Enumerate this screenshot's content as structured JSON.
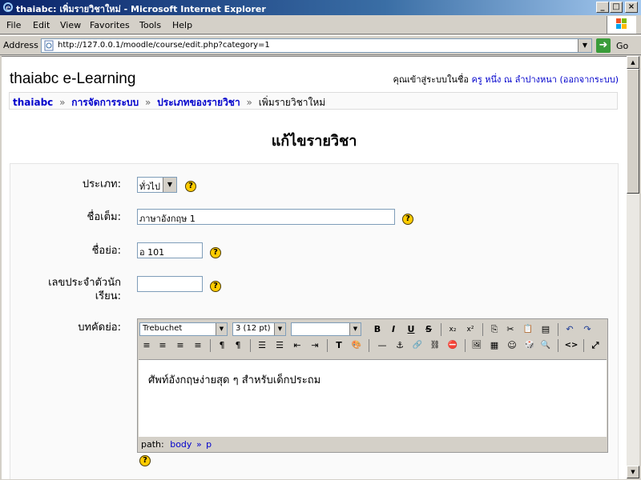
{
  "window": {
    "title": "thaiabc: เพิ่มรายวิชาใหม่ - Microsoft Internet Explorer",
    "buttons": {
      "minimize": "_",
      "maximize": "□",
      "close": "×"
    }
  },
  "menu": [
    "File",
    "Edit",
    "View",
    "Favorites",
    "Tools",
    "Help"
  ],
  "address": {
    "label": "Address",
    "url": "http://127.0.0.1/moodle/course/edit.php?category=1",
    "go_label": "Go"
  },
  "page": {
    "site_name": "thaiabc e-Learning",
    "login": {
      "prefix": "คุณเข้าสู่ระบบในชื่อ",
      "user": "ครู หนึ่ง ณ ลำปางหนา",
      "logout_open": "(",
      "logout": "ออกจากระบบ",
      "logout_close": ")"
    },
    "breadcrumb": {
      "items": [
        "thaiabc",
        "การจัดการระบบ",
        "ประเภทของรายวิชา"
      ],
      "current": "เพิ่มรายวิชาใหม่",
      "separator": "»"
    },
    "heading": "แก้ไขรายวิชา",
    "form": {
      "category": {
        "label": "ประเภท:",
        "value": "ทั่วไป"
      },
      "fullname": {
        "label": "ชื่อเต็ม:",
        "value": "ภาษาอังกฤษ 1"
      },
      "shortname": {
        "label": "ชื่อย่อ:",
        "value": "อ 101"
      },
      "idnumber": {
        "label1": "เลขประจำตัวนัก",
        "label2": "เรียน:",
        "value": ""
      },
      "summary": {
        "label": "บทคัดย่อ:"
      }
    },
    "editor": {
      "font": "Trebuchet",
      "size": "3 (12 pt)",
      "style": "",
      "content": "ศัพท์อังกฤษง่ายสุด ๆ สำหรับเด็กประถม",
      "path_label": "path:",
      "path_items": [
        "body",
        "p"
      ],
      "path_sep": "»",
      "buttons_row1": [
        "B",
        "I",
        "U",
        "S",
        "x₂",
        "x²",
        "⎘",
        "✂",
        "📋",
        "▤",
        "↶",
        "↷"
      ],
      "buttons_row2": [
        "≡",
        "≡",
        "≡",
        "≡",
        "¶",
        "¶",
        "☰",
        "☰",
        "⇤",
        "⇥",
        "T",
        "🎨",
        "—",
        "⚓",
        "🔗",
        "⛓",
        "⛔",
        "🖼",
        "▦",
        "☺",
        "🎲",
        "🔍",
        "<>",
        "⤢"
      ]
    },
    "help_symbol": "?"
  },
  "colors": {
    "link": "#0000cc",
    "titlebar": "#0a246a",
    "help": "#ffcc00"
  }
}
